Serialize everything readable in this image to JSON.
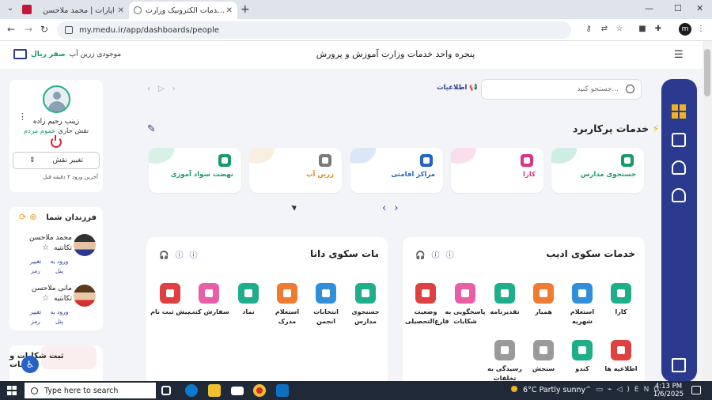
{
  "browser": {
    "tabs": [
      {
        "title": "آپارات | محمد ملاحسن"
      },
      {
        "title": "پنجره واحد خدمات الکترونیک وزارت"
      }
    ],
    "url": "my.medu.ir/app/dashboards/people",
    "profile_initial": "m"
  },
  "header": {
    "title": "پنجره واحد خدمات وزارت آموزش و پرورش",
    "wallet_label": "موجودی زرین آپ",
    "wallet_value": "صفر ریال"
  },
  "search": {
    "placeholder": "جستجو کنید..."
  },
  "notice_label": "اطلاعیات",
  "profile": {
    "name": "زینب رحیم زاده",
    "role_label": "نقش جاری",
    "role_value": "عموم مردم",
    "change_role": "تغییر نقش",
    "last_login": "آخرین ورود ۴ دقیقه قبل"
  },
  "children": {
    "title": "فرزندان شما",
    "enter_panel": "ورود به پنل",
    "change_password": "تغییر رمز",
    "items": [
      {
        "name": "محمد ملاحسن",
        "school": "تکانتیه"
      },
      {
        "name": "مانی ملاحسن",
        "school": "تکانتیه"
      }
    ]
  },
  "complaints": {
    "title": "ثبت شکایات و تخلفات"
  },
  "fast_services": {
    "title": "خدمات پرکاربرد",
    "items": [
      {
        "label": "جستجوی مدارس",
        "color": "#1a9a6a",
        "blob": "#a8e0cc",
        "text_color": "#1a9a6a"
      },
      {
        "label": "کارا",
        "color": "#d6338a",
        "blob": "#f6c2dc",
        "text_color": "#d6338a"
      },
      {
        "label": "مراکز اقامتی",
        "color": "#2563c8",
        "blob": "#bcd4f2",
        "text_color": "#2563c8"
      },
      {
        "label": "زرین آپ",
        "color": "#7a7a7a",
        "blob": "#f3e2c8",
        "text_color": "#e08a10"
      },
      {
        "label": "نهضت سواد آموزی",
        "color": "#1a9a6a",
        "blob": "#b8e6d4",
        "text_color": "#1a9a6a"
      }
    ]
  },
  "adib_panel": {
    "title": "خدمات سکوی ادیب",
    "items": [
      {
        "label": "کارا",
        "color": "#1fae8a"
      },
      {
        "label": "استعلام شهریه",
        "color": "#2f8fd8"
      },
      {
        "label": "همیار",
        "color": "#f07a30"
      },
      {
        "label": "تقدیرنامه",
        "color": "#1fae8a"
      },
      {
        "label": "پاسخگویی به شکایات",
        "color": "#e85fa8"
      },
      {
        "label": "وضعیت فارغ‌التحصیلی",
        "color": "#e04040"
      },
      {
        "label": "اطلاعیه ها",
        "color": "#e04040"
      },
      {
        "label": "کندو",
        "color": "#1fae8a"
      },
      {
        "label": "سنجش",
        "color": "#9a9a9a"
      },
      {
        "label": "رسیدگی به تخلفات اداری",
        "color": "#9a9a9a"
      }
    ]
  },
  "dana_panel": {
    "title": "خدمات سکوی دانا",
    "items": [
      {
        "label": "جستجوی مدارس",
        "color": "#1fae8a"
      },
      {
        "label": "انتخابات انجمن",
        "color": "#2f8fd8"
      },
      {
        "label": "استعلام مدرک",
        "color": "#f07a30"
      },
      {
        "label": "نماد",
        "color": "#1fae8a"
      },
      {
        "label": "سفارش کتب",
        "color": "#e85fa8"
      },
      {
        "label": "پیش ثبت نام",
        "color": "#e04040"
      }
    ]
  },
  "taskbar": {
    "search_placeholder": "Type here to search",
    "weather_temp": "6°C",
    "weather_desc": "Partly sunny",
    "time": "4:13 PM",
    "date": "1/6/2025"
  }
}
